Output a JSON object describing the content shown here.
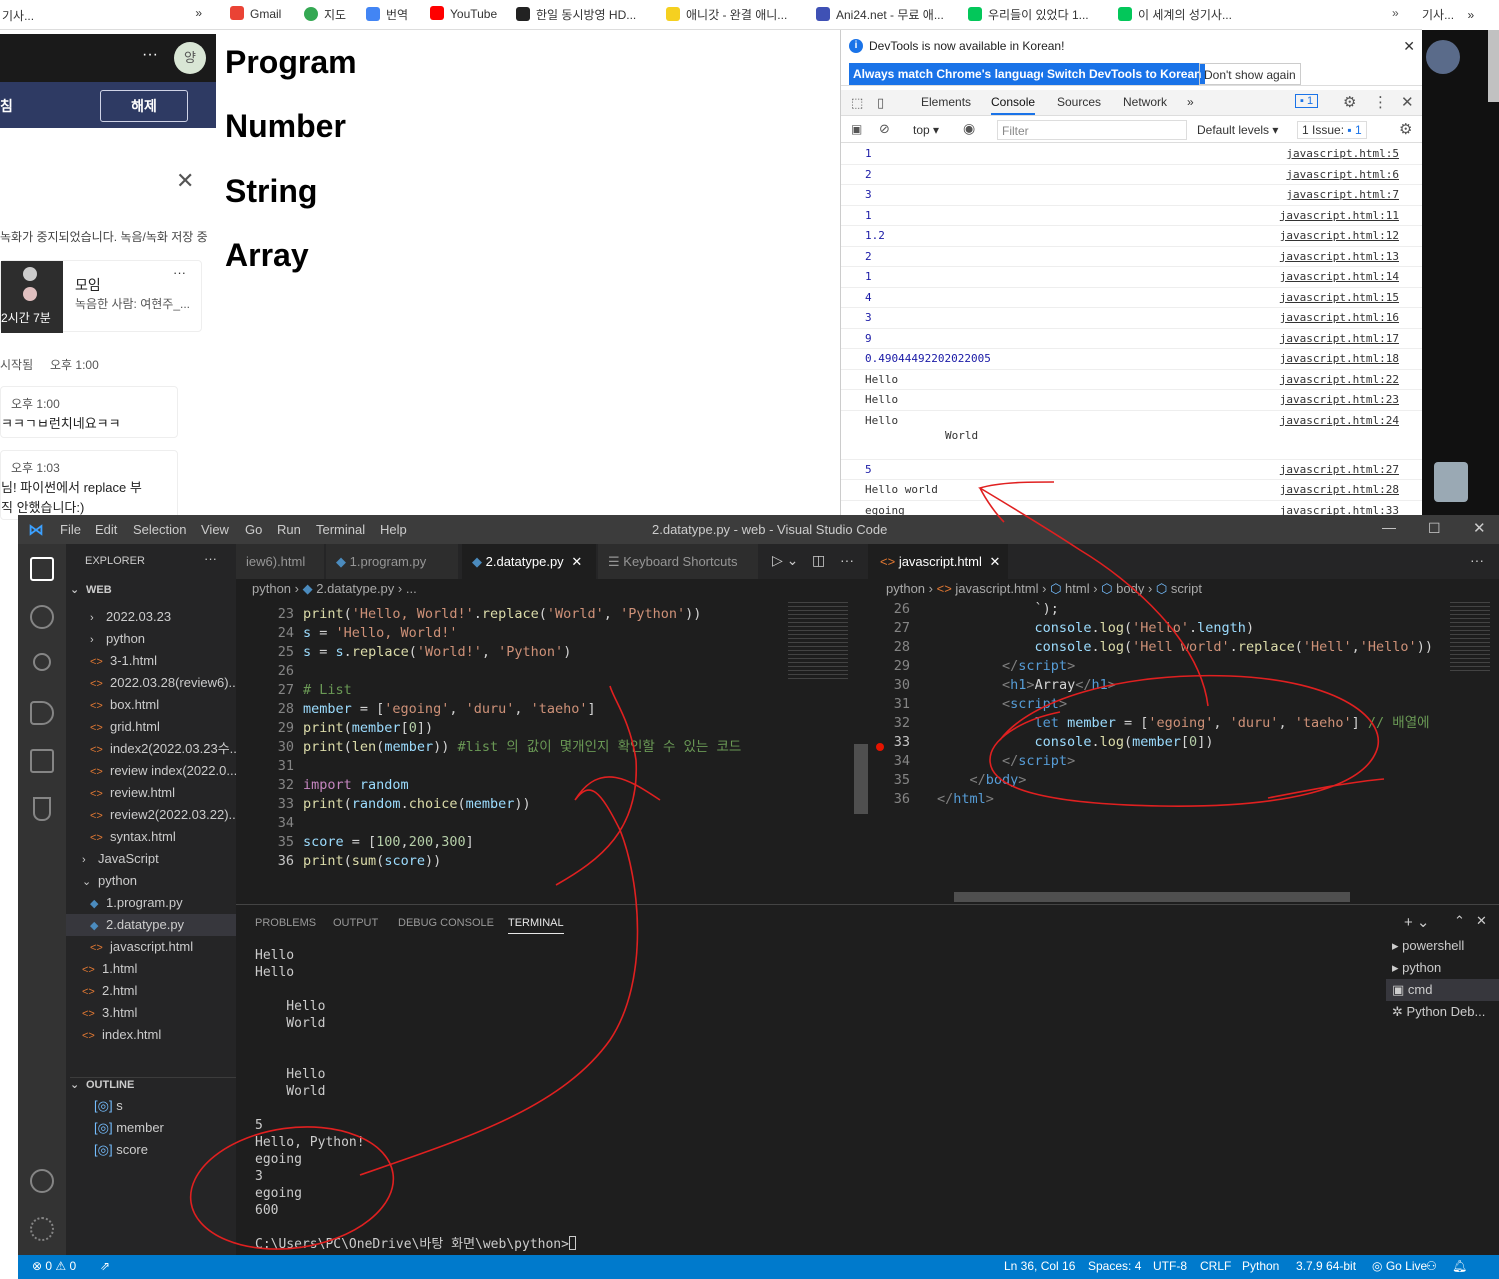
{
  "left_app": {
    "tab_title": "기사...",
    "release_button": "해제",
    "header_left": "침",
    "recording_notice": "녹화가 중지되었습니다. 녹음/녹화 저장 중",
    "card_title": "모임",
    "card_subtitle": "녹음한 사람: 여현주_...",
    "card_duration": "2시간 7분",
    "started_label": "시작됨",
    "started_time": "오후 1:00",
    "msg1_time": "오후 1:00",
    "msg1_text": "ㅋㅋㄱㅂ런치네요ㅋㅋ",
    "msg2_time": "오후 1:03",
    "msg2_line1": "님! 파이썬에서 replace 부",
    "msg2_line2": "직 안했습니다:)",
    "avatar": "양"
  },
  "bookmarks": [
    "Gmail",
    "지도",
    "번역",
    "YouTube",
    "한일 동시방영 HD...",
    "애니갓 - 완결 애니...",
    "Ani24.net - 무료 애...",
    "우리들이 있었다 1...",
    "이 세계의 성기사...",
    "기사..."
  ],
  "page": {
    "headings": [
      "Program",
      "Number",
      "String",
      "Array"
    ]
  },
  "devtools": {
    "info_text": "DevTools is now available in Korean!",
    "btn_match": "Always match Chrome's language",
    "btn_switch": "Switch DevTools to Korean",
    "btn_dont": "Don't show again",
    "tabs": [
      "Elements",
      "Console",
      "Sources",
      "Network"
    ],
    "badge": "1",
    "context": "top",
    "filter_placeholder": "Filter",
    "levels": "Default levels",
    "issues": "1 Issue:",
    "issues_count": "1",
    "log": [
      {
        "v": "1",
        "src": "javascript.html:5",
        "num": true
      },
      {
        "v": "2",
        "src": "javascript.html:6",
        "num": true
      },
      {
        "v": "3",
        "src": "javascript.html:7",
        "num": true
      },
      {
        "v": "1",
        "src": "javascript.html:11",
        "num": true
      },
      {
        "v": "1.2",
        "src": "javascript.html:12",
        "num": true
      },
      {
        "v": "2",
        "src": "javascript.html:13",
        "num": true
      },
      {
        "v": "1",
        "src": "javascript.html:14",
        "num": true
      },
      {
        "v": "4",
        "src": "javascript.html:15",
        "num": true
      },
      {
        "v": "3",
        "src": "javascript.html:16",
        "num": true
      },
      {
        "v": "9",
        "src": "javascript.html:17",
        "num": true
      },
      {
        "v": "0.49044492202022005",
        "src": "javascript.html:18",
        "num": true
      },
      {
        "v": "Hello",
        "src": "javascript.html:22",
        "num": false
      },
      {
        "v": "Hello",
        "src": "javascript.html:23",
        "num": false
      },
      {
        "v": "Hello",
        "src": "javascript.html:24",
        "num": false
      },
      {
        "v": "5",
        "src": "javascript.html:27",
        "num": true
      },
      {
        "v": "Hello world",
        "src": "javascript.html:28",
        "num": false
      },
      {
        "v": "egoing",
        "src": "javascript.html:33",
        "num": false
      }
    ],
    "world_continuation": "World"
  },
  "vscode": {
    "menu": [
      "File",
      "Edit",
      "Selection",
      "View",
      "Go",
      "Run",
      "Terminal",
      "Help"
    ],
    "window_title": "2.datatype.py - web - Visual Studio Code",
    "explorer_title": "EXPLORER",
    "root": "WEB",
    "tree": [
      {
        "label": "2022.03.23",
        "indent": 1,
        "kind": "folder"
      },
      {
        "label": "python",
        "indent": 1,
        "kind": "folder"
      },
      {
        "label": "3-1.html",
        "indent": 1,
        "kind": "html"
      },
      {
        "label": "2022.03.28(review6)....",
        "indent": 1,
        "kind": "html"
      },
      {
        "label": "box.html",
        "indent": 1,
        "kind": "html"
      },
      {
        "label": "grid.html",
        "indent": 1,
        "kind": "html"
      },
      {
        "label": "index2(2022.03.23수...",
        "indent": 1,
        "kind": "html"
      },
      {
        "label": "review index(2022.0...",
        "indent": 1,
        "kind": "html"
      },
      {
        "label": "review.html",
        "indent": 1,
        "kind": "html"
      },
      {
        "label": "review2(2022.03.22)....",
        "indent": 1,
        "kind": "html"
      },
      {
        "label": "syntax.html",
        "indent": 1,
        "kind": "html"
      },
      {
        "label": "JavaScript",
        "indent": 0,
        "kind": "folder"
      },
      {
        "label": "python",
        "indent": 0,
        "kind": "folder-open"
      },
      {
        "label": "1.program.py",
        "indent": 1,
        "kind": "py"
      },
      {
        "label": "2.datatype.py",
        "indent": 1,
        "kind": "py",
        "selected": true
      },
      {
        "label": "javascript.html",
        "indent": 1,
        "kind": "html"
      },
      {
        "label": "1.html",
        "indent": 0,
        "kind": "html"
      },
      {
        "label": "2.html",
        "indent": 0,
        "kind": "html"
      },
      {
        "label": "3.html",
        "indent": 0,
        "kind": "html"
      },
      {
        "label": "index.html",
        "indent": 0,
        "kind": "html"
      }
    ],
    "outline_title": "OUTLINE",
    "outline": [
      "s",
      "member",
      "score"
    ],
    "tabs_left": [
      "iew6).html",
      "1.program.py",
      "2.datatype.py",
      "Keyboard Shortcuts"
    ],
    "tabs_right": [
      "javascript.html"
    ],
    "crumbs_left": [
      "python",
      "2.datatype.py",
      "..."
    ],
    "crumbs_right": [
      "python",
      "javascript.html",
      "html",
      "body",
      "script"
    ],
    "panel_tabs": [
      "PROBLEMS",
      "OUTPUT",
      "DEBUG CONSOLE",
      "TERMINAL"
    ],
    "terminal_text": "Hello\nHello\n\n    Hello\n    World\n\n\n    Hello\n    World\n\n5\nHello, Python!\negoing\n3\negoing\n600\n\nC:\\Users\\PC\\OneDrive\\바탕 화면\\web\\python>",
    "terminals": [
      "powershell",
      "python",
      "cmd",
      "Python Deb..."
    ],
    "status": {
      "errors": "0",
      "warnings": "0",
      "position": "Ln 36, Col 16",
      "spaces": "Spaces: 4",
      "encoding": "UTF-8",
      "eol": "CRLF",
      "language": "Python",
      "interpreter": "3.7.9 64-bit",
      "golive": "Go Live"
    }
  },
  "colors": {
    "vscode_blue": "#007acc",
    "chrome_blue": "#1a73e8",
    "annotation_red": "#e02020"
  }
}
